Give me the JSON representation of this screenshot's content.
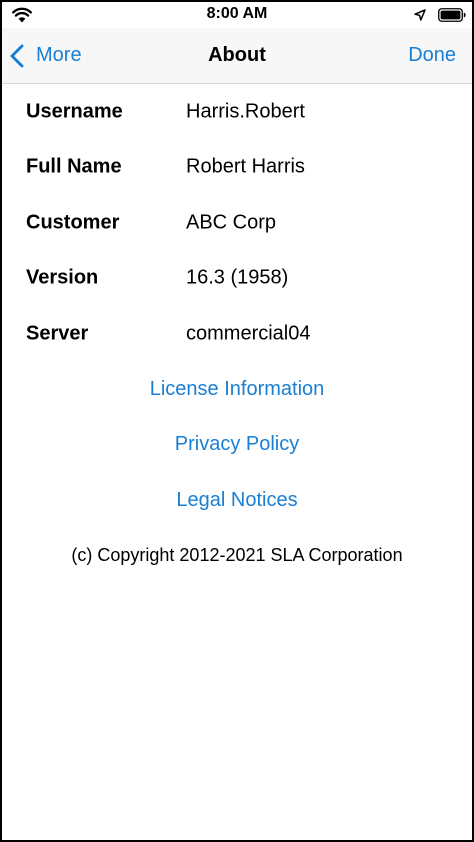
{
  "status_bar": {
    "time": "8:00 AM",
    "icons": [
      "wifi-icon",
      "location-icon",
      "battery-icon"
    ]
  },
  "nav": {
    "back_label": "More",
    "title": "About",
    "done_label": "Done"
  },
  "info": {
    "username_label": "Username",
    "username_value": "Harris.Robert",
    "fullname_label": "Full Name",
    "fullname_value": "Robert Harris",
    "customer_label": "Customer",
    "customer_value": "ABC Corp",
    "version_label": "Version",
    "version_value": "16.3 (1958)",
    "server_label": "Server",
    "server_value": "commercial04"
  },
  "links": {
    "license": "License Information",
    "privacy": "Privacy Policy",
    "legal": "Legal Notices"
  },
  "copyright": "(c) Copyright 2012-2021 SLA Corporation",
  "colors": {
    "accent": "#1a7fd4",
    "nav_background": "#f7f7f7",
    "text": "#000000"
  }
}
